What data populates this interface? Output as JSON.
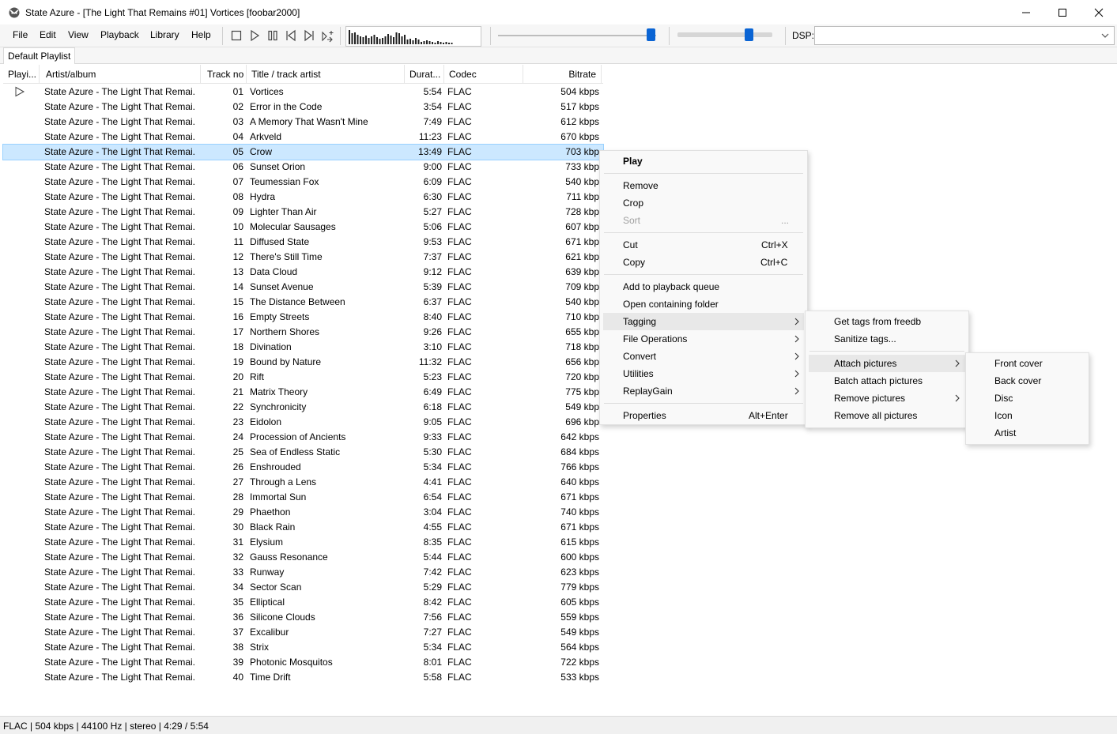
{
  "window": {
    "title": "State Azure - [The Light That Remains #01] Vortices  [foobar2000]"
  },
  "menubar": [
    "File",
    "Edit",
    "View",
    "Playback",
    "Library",
    "Help"
  ],
  "toolbar": {
    "buttons": [
      "stop-icon",
      "play-icon",
      "pause-icon",
      "previous-icon",
      "next-icon",
      "random-icon"
    ],
    "seek_fraction": 0.97,
    "volume_fraction": 0.75,
    "dsp_label": "DSP:",
    "dsp_value": ""
  },
  "visualizer_bars": [
    18,
    14,
    15,
    12,
    10,
    9,
    11,
    8,
    10,
    12,
    9,
    7,
    8,
    10,
    13,
    11,
    9,
    15,
    14,
    10,
    12,
    6,
    7,
    5,
    8,
    6,
    3,
    4,
    5,
    4,
    3,
    2,
    4,
    3,
    2,
    3,
    2,
    2
  ],
  "playlist_tab": "Default Playlist",
  "columns": {
    "playing": "Playi...",
    "artist": "Artist/album",
    "track": "Track no",
    "title": "Title / track artist",
    "duration": "Durat...",
    "codec": "Codec",
    "bitrate": "Bitrate"
  },
  "rows": [
    {
      "artist": "State Azure - The Light That Remai...",
      "track": "01",
      "title": "Vortices",
      "duration": "5:54",
      "codec": "FLAC",
      "bitrate": "504 kbps",
      "playing": true
    },
    {
      "artist": "State Azure - The Light That Remai...",
      "track": "02",
      "title": "Error in the Code",
      "duration": "3:54",
      "codec": "FLAC",
      "bitrate": "517 kbps"
    },
    {
      "artist": "State Azure - The Light That Remai...",
      "track": "03",
      "title": "A Memory That Wasn't Mine",
      "duration": "7:49",
      "codec": "FLAC",
      "bitrate": "612 kbps"
    },
    {
      "artist": "State Azure - The Light That Remai...",
      "track": "04",
      "title": "Arkveld",
      "duration": "11:23",
      "codec": "FLAC",
      "bitrate": "670 kbps"
    },
    {
      "artist": "State Azure - The Light That Remai...",
      "track": "05",
      "title": "Crow",
      "duration": "13:49",
      "codec": "FLAC",
      "bitrate": "703 kbp",
      "selected": true
    },
    {
      "artist": "State Azure - The Light That Remai...",
      "track": "06",
      "title": "Sunset Orion",
      "duration": "9:00",
      "codec": "FLAC",
      "bitrate": "733 kbp"
    },
    {
      "artist": "State Azure - The Light That Remai...",
      "track": "07",
      "title": "Teumessian Fox",
      "duration": "6:09",
      "codec": "FLAC",
      "bitrate": "540 kbp"
    },
    {
      "artist": "State Azure - The Light That Remai...",
      "track": "08",
      "title": "Hydra",
      "duration": "6:30",
      "codec": "FLAC",
      "bitrate": "711 kbp"
    },
    {
      "artist": "State Azure - The Light That Remai...",
      "track": "09",
      "title": "Lighter Than Air",
      "duration": "5:27",
      "codec": "FLAC",
      "bitrate": "728 kbp"
    },
    {
      "artist": "State Azure - The Light That Remai...",
      "track": "10",
      "title": "Molecular Sausages",
      "duration": "5:06",
      "codec": "FLAC",
      "bitrate": "607 kbp"
    },
    {
      "artist": "State Azure - The Light That Remai...",
      "track": "11",
      "title": "Diffused State",
      "duration": "9:53",
      "codec": "FLAC",
      "bitrate": "671 kbp"
    },
    {
      "artist": "State Azure - The Light That Remai...",
      "track": "12",
      "title": "There's Still Time",
      "duration": "7:37",
      "codec": "FLAC",
      "bitrate": "621 kbp"
    },
    {
      "artist": "State Azure - The Light That Remai...",
      "track": "13",
      "title": "Data Cloud",
      "duration": "9:12",
      "codec": "FLAC",
      "bitrate": "639 kbp"
    },
    {
      "artist": "State Azure - The Light That Remai...",
      "track": "14",
      "title": "Sunset Avenue",
      "duration": "5:39",
      "codec": "FLAC",
      "bitrate": "709 kbp"
    },
    {
      "artist": "State Azure - The Light That Remai...",
      "track": "15",
      "title": "The Distance Between",
      "duration": "6:37",
      "codec": "FLAC",
      "bitrate": "540 kbp"
    },
    {
      "artist": "State Azure - The Light That Remai...",
      "track": "16",
      "title": "Empty Streets",
      "duration": "8:40",
      "codec": "FLAC",
      "bitrate": "710 kbp"
    },
    {
      "artist": "State Azure - The Light That Remai...",
      "track": "17",
      "title": "Northern Shores",
      "duration": "9:26",
      "codec": "FLAC",
      "bitrate": "655 kbp"
    },
    {
      "artist": "State Azure - The Light That Remai...",
      "track": "18",
      "title": "Divination",
      "duration": "3:10",
      "codec": "FLAC",
      "bitrate": "718 kbp"
    },
    {
      "artist": "State Azure - The Light That Remai...",
      "track": "19",
      "title": "Bound by Nature",
      "duration": "11:32",
      "codec": "FLAC",
      "bitrate": "656 kbp"
    },
    {
      "artist": "State Azure - The Light That Remai...",
      "track": "20",
      "title": "Rift",
      "duration": "5:23",
      "codec": "FLAC",
      "bitrate": "720 kbp"
    },
    {
      "artist": "State Azure - The Light That Remai...",
      "track": "21",
      "title": "Matrix Theory",
      "duration": "6:49",
      "codec": "FLAC",
      "bitrate": "775 kbp"
    },
    {
      "artist": "State Azure - The Light That Remai...",
      "track": "22",
      "title": "Synchronicity",
      "duration": "6:18",
      "codec": "FLAC",
      "bitrate": "549 kbp"
    },
    {
      "artist": "State Azure - The Light That Remai...",
      "track": "23",
      "title": "Eidolon",
      "duration": "9:05",
      "codec": "FLAC",
      "bitrate": "696 kbp"
    },
    {
      "artist": "State Azure - The Light That Remai...",
      "track": "24",
      "title": "Procession of Ancients",
      "duration": "9:33",
      "codec": "FLAC",
      "bitrate": "642 kbps"
    },
    {
      "artist": "State Azure - The Light That Remai...",
      "track": "25",
      "title": "Sea of Endless Static",
      "duration": "5:30",
      "codec": "FLAC",
      "bitrate": "684 kbps"
    },
    {
      "artist": "State Azure - The Light That Remai...",
      "track": "26",
      "title": "Enshrouded",
      "duration": "5:34",
      "codec": "FLAC",
      "bitrate": "766 kbps"
    },
    {
      "artist": "State Azure - The Light That Remai...",
      "track": "27",
      "title": "Through a Lens",
      "duration": "4:41",
      "codec": "FLAC",
      "bitrate": "640 kbps"
    },
    {
      "artist": "State Azure - The Light That Remai...",
      "track": "28",
      "title": "Immortal Sun",
      "duration": "6:54",
      "codec": "FLAC",
      "bitrate": "671 kbps"
    },
    {
      "artist": "State Azure - The Light That Remai...",
      "track": "29",
      "title": "Phaethon",
      "duration": "3:04",
      "codec": "FLAC",
      "bitrate": "740 kbps"
    },
    {
      "artist": "State Azure - The Light That Remai...",
      "track": "30",
      "title": "Black Rain",
      "duration": "4:55",
      "codec": "FLAC",
      "bitrate": "671 kbps"
    },
    {
      "artist": "State Azure - The Light That Remai...",
      "track": "31",
      "title": "Elysium",
      "duration": "8:35",
      "codec": "FLAC",
      "bitrate": "615 kbps"
    },
    {
      "artist": "State Azure - The Light That Remai...",
      "track": "32",
      "title": "Gauss Resonance",
      "duration": "5:44",
      "codec": "FLAC",
      "bitrate": "600 kbps"
    },
    {
      "artist": "State Azure - The Light That Remai...",
      "track": "33",
      "title": "Runway",
      "duration": "7:42",
      "codec": "FLAC",
      "bitrate": "623 kbps"
    },
    {
      "artist": "State Azure - The Light That Remai...",
      "track": "34",
      "title": "Sector Scan",
      "duration": "5:29",
      "codec": "FLAC",
      "bitrate": "779 kbps"
    },
    {
      "artist": "State Azure - The Light That Remai...",
      "track": "35",
      "title": "Elliptical",
      "duration": "8:42",
      "codec": "FLAC",
      "bitrate": "605 kbps"
    },
    {
      "artist": "State Azure - The Light That Remai...",
      "track": "36",
      "title": "Silicone Clouds",
      "duration": "7:56",
      "codec": "FLAC",
      "bitrate": "559 kbps"
    },
    {
      "artist": "State Azure - The Light That Remai...",
      "track": "37",
      "title": "Excalibur",
      "duration": "7:27",
      "codec": "FLAC",
      "bitrate": "549 kbps"
    },
    {
      "artist": "State Azure - The Light That Remai...",
      "track": "38",
      "title": "Strix",
      "duration": "5:34",
      "codec": "FLAC",
      "bitrate": "564 kbps"
    },
    {
      "artist": "State Azure - The Light That Remai...",
      "track": "39",
      "title": "Photonic Mosquitos",
      "duration": "8:01",
      "codec": "FLAC",
      "bitrate": "722 kbps"
    },
    {
      "artist": "State Azure - The Light That Remai...",
      "track": "40",
      "title": "Time Drift",
      "duration": "5:58",
      "codec": "FLAC",
      "bitrate": "533 kbps"
    }
  ],
  "context_menu": {
    "play": "Play",
    "remove": "Remove",
    "crop": "Crop",
    "sort": "Sort",
    "sort_extra": "...",
    "cut": "Cut",
    "cut_shortcut": "Ctrl+X",
    "copy": "Copy",
    "copy_shortcut": "Ctrl+C",
    "add_queue": "Add to playback queue",
    "open_folder": "Open containing folder",
    "tagging": "Tagging",
    "file_operations": "File Operations",
    "convert": "Convert",
    "utilities": "Utilities",
    "replaygain": "ReplayGain",
    "properties": "Properties",
    "properties_shortcut": "Alt+Enter"
  },
  "tagging_menu": {
    "freedb": "Get tags from freedb",
    "sanitize": "Sanitize tags...",
    "attach": "Attach pictures",
    "batch_attach": "Batch attach pictures",
    "remove_pictures": "Remove pictures",
    "remove_all": "Remove all pictures"
  },
  "attach_menu": [
    "Front cover",
    "Back cover",
    "Disc",
    "Icon",
    "Artist"
  ],
  "statusbar": {
    "text": "FLAC | 504 kbps | 44100 Hz | stereo | 4:29 / 5:54"
  }
}
